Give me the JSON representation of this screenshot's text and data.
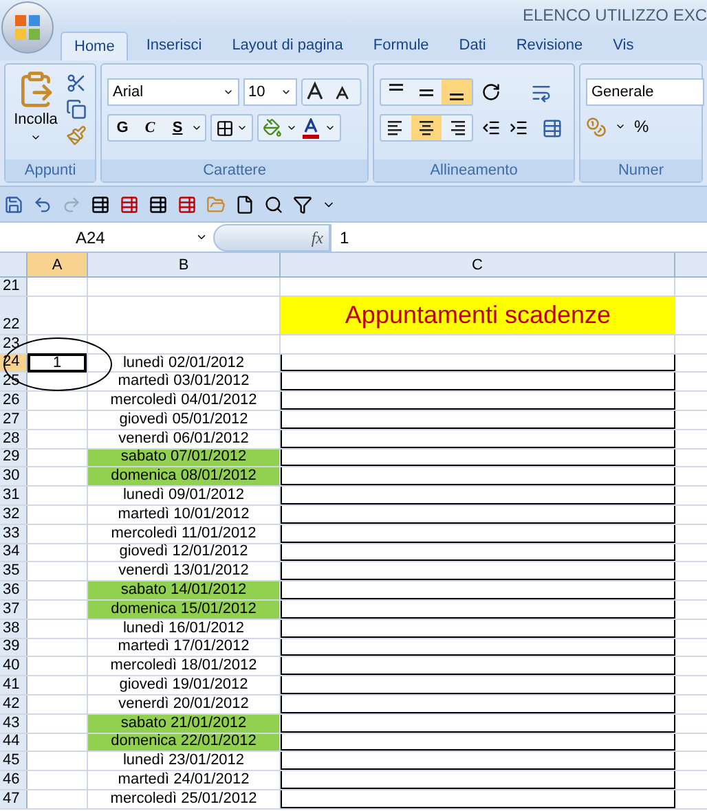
{
  "window": {
    "title": "ELENCO UTILIZZO EXC"
  },
  "tabs": [
    {
      "label": "Home",
      "selected": true
    },
    {
      "label": "Inserisci",
      "selected": false
    },
    {
      "label": "Layout di pagina",
      "selected": false
    },
    {
      "label": "Formule",
      "selected": false
    },
    {
      "label": "Dati",
      "selected": false
    },
    {
      "label": "Revisione",
      "selected": false
    },
    {
      "label": "Vis",
      "selected": false
    }
  ],
  "ribbon": {
    "clipboard": {
      "paste_label": "Incolla",
      "group_label": "Appunti"
    },
    "font": {
      "font_name": "Arial",
      "font_size": "10",
      "bold": "G",
      "italic": "C",
      "underline": "S",
      "group_label": "Carattere"
    },
    "alignment": {
      "vertical": [
        {
          "kind": "top",
          "selected": false
        },
        {
          "kind": "middle",
          "selected": false
        },
        {
          "kind": "bottom",
          "selected": true
        }
      ],
      "horizontal": [
        {
          "kind": "left",
          "selected": false
        },
        {
          "kind": "center",
          "selected": true
        },
        {
          "kind": "right",
          "selected": false
        }
      ],
      "group_label": "Allineamento"
    },
    "number": {
      "format": "Generale",
      "percent": "%",
      "group_label": "Numer"
    }
  },
  "formula_bar": {
    "name_box": "A24",
    "fx": "fx",
    "value": "1"
  },
  "columns": [
    {
      "label": "A",
      "selected": true
    },
    {
      "label": "B",
      "selected": false
    },
    {
      "label": "C",
      "selected": false
    }
  ],
  "rows": [
    {
      "number": "21",
      "kind": "blank",
      "selected": false
    },
    {
      "number": "22",
      "kind": "title",
      "selected": false,
      "c": "Appuntamenti scadenze"
    },
    {
      "number": "23",
      "kind": "blank",
      "selected": false
    },
    {
      "number": "24",
      "kind": "entry",
      "selected": true,
      "a": "1",
      "b": "lunedì 02/01/2012",
      "weekend": false
    },
    {
      "number": "25",
      "kind": "entry",
      "selected": false,
      "b": "martedì 03/01/2012",
      "weekend": false
    },
    {
      "number": "26",
      "kind": "entry",
      "selected": false,
      "b": "mercoledì 04/01/2012",
      "weekend": false
    },
    {
      "number": "27",
      "kind": "entry",
      "selected": false,
      "b": "giovedì 05/01/2012",
      "weekend": false
    },
    {
      "number": "28",
      "kind": "entry",
      "selected": false,
      "b": "venerdì 06/01/2012",
      "weekend": false
    },
    {
      "number": "29",
      "kind": "entry",
      "selected": false,
      "b": "sabato 07/01/2012",
      "weekend": true
    },
    {
      "number": "30",
      "kind": "entry",
      "selected": false,
      "b": "domenica 08/01/2012",
      "weekend": true
    },
    {
      "number": "31",
      "kind": "entry",
      "selected": false,
      "b": "lunedì 09/01/2012",
      "weekend": false
    },
    {
      "number": "32",
      "kind": "entry",
      "selected": false,
      "b": "martedì 10/01/2012",
      "weekend": false
    },
    {
      "number": "33",
      "kind": "entry",
      "selected": false,
      "b": "mercoledì 11/01/2012",
      "weekend": false
    },
    {
      "number": "34",
      "kind": "entry",
      "selected": false,
      "b": "giovedì 12/01/2012",
      "weekend": false
    },
    {
      "number": "35",
      "kind": "entry",
      "selected": false,
      "b": "venerdì 13/01/2012",
      "weekend": false
    },
    {
      "number": "36",
      "kind": "entry",
      "selected": false,
      "b": "sabato 14/01/2012",
      "weekend": true
    },
    {
      "number": "37",
      "kind": "entry",
      "selected": false,
      "b": "domenica 15/01/2012",
      "weekend": true
    },
    {
      "number": "38",
      "kind": "entry",
      "selected": false,
      "b": "lunedì 16/01/2012",
      "weekend": false
    },
    {
      "number": "39",
      "kind": "entry",
      "selected": false,
      "b": "martedì 17/01/2012",
      "weekend": false
    },
    {
      "number": "40",
      "kind": "entry",
      "selected": false,
      "b": "mercoledì 18/01/2012",
      "weekend": false
    },
    {
      "number": "41",
      "kind": "entry",
      "selected": false,
      "b": "giovedì 19/01/2012",
      "weekend": false
    },
    {
      "number": "42",
      "kind": "entry",
      "selected": false,
      "b": "venerdì 20/01/2012",
      "weekend": false
    },
    {
      "number": "43",
      "kind": "entry",
      "selected": false,
      "b": "sabato 21/01/2012",
      "weekend": true
    },
    {
      "number": "44",
      "kind": "entry",
      "selected": false,
      "b": "domenica 22/01/2012",
      "weekend": true
    },
    {
      "number": "45",
      "kind": "entry",
      "selected": false,
      "b": "lunedì 23/01/2012",
      "weekend": false
    },
    {
      "number": "46",
      "kind": "entry",
      "selected": false,
      "b": "martedì 24/01/2012",
      "weekend": false
    },
    {
      "number": "47",
      "kind": "entry",
      "selected": false,
      "b": "mercoledì 25/01/2012",
      "weekend": false
    }
  ]
}
